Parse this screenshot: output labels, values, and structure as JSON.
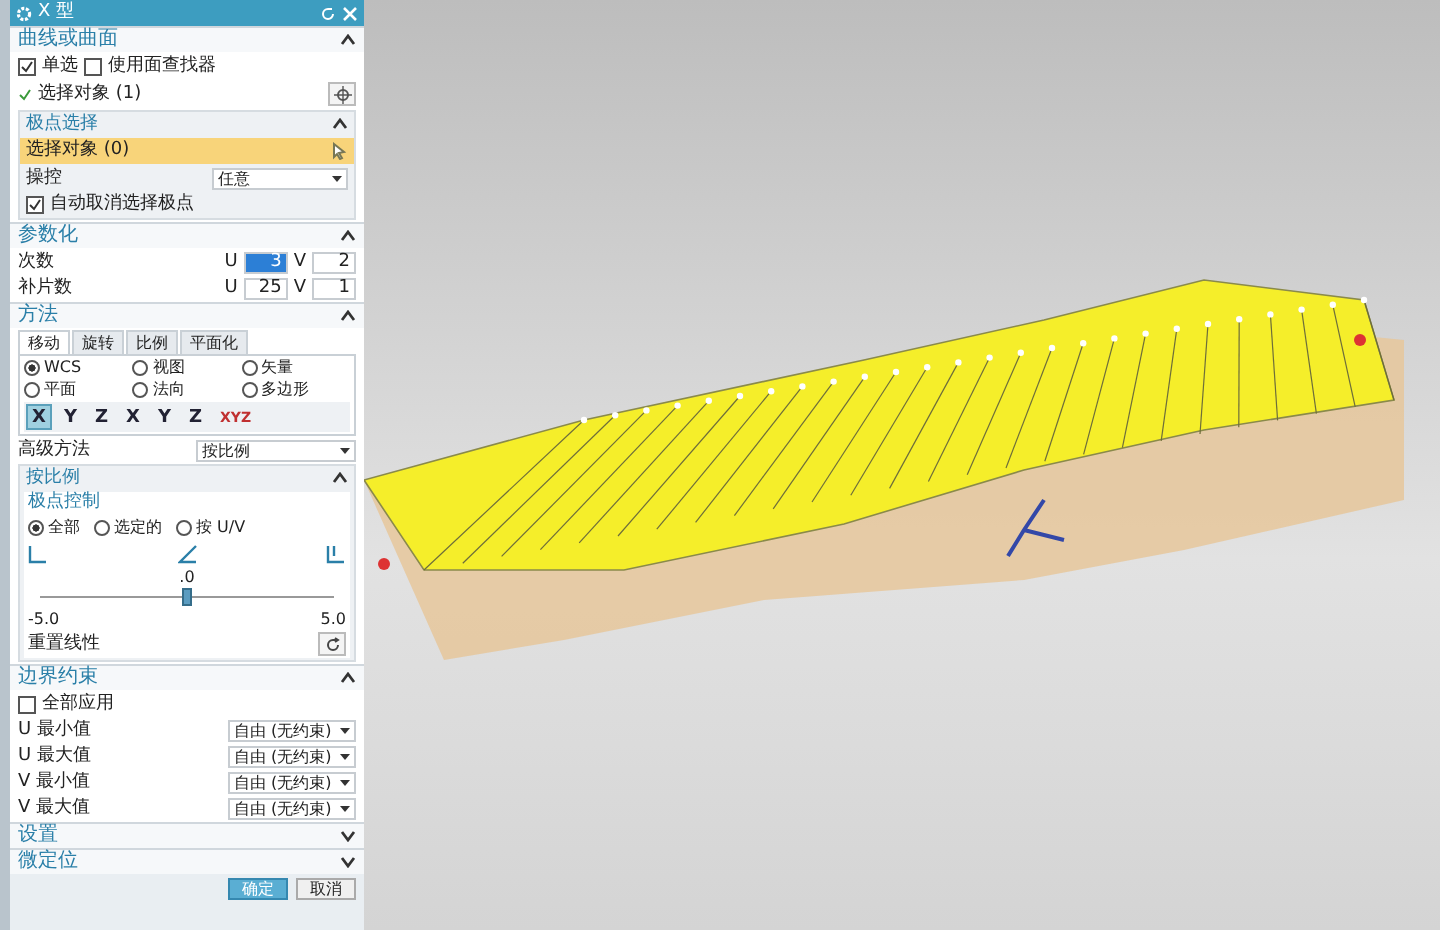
{
  "window": {
    "title": "X 型"
  },
  "curve_section": {
    "title": "曲线或曲面",
    "expanded": true,
    "checkboxes": [
      {
        "label": "单选",
        "checked": true
      },
      {
        "label": "使用面查找器",
        "checked": false
      }
    ],
    "select_label": "选择对象 (1)",
    "pole_group": {
      "title": "极点选择",
      "expanded": true,
      "select_label": "选择对象 (0)",
      "manipulate_label": "操控",
      "manipulate_value": "任意",
      "auto_deselect": {
        "label": "自动取消选择极点",
        "checked": true
      }
    }
  },
  "param_section": {
    "title": "参数化",
    "expanded": true,
    "rows": [
      {
        "label": "次数",
        "u_label": "U",
        "u_value": "3",
        "u_focused": true,
        "v_label": "V",
        "v_value": "2"
      },
      {
        "label": "补片数",
        "u_label": "U",
        "u_value": "25",
        "u_focused": false,
        "v_label": "V",
        "v_value": "1"
      }
    ]
  },
  "method_section": {
    "title": "方法",
    "expanded": true,
    "tabs": [
      {
        "label": "移动",
        "selected": true
      },
      {
        "label": "旋转",
        "selected": false
      },
      {
        "label": "比例",
        "selected": false
      },
      {
        "label": "平面化",
        "selected": false
      }
    ],
    "radios": [
      {
        "label": "WCS",
        "selected": true
      },
      {
        "label": "视图",
        "selected": false
      },
      {
        "label": "矢量",
        "selected": false
      },
      {
        "label": "平面",
        "selected": false
      },
      {
        "label": "法向",
        "selected": false
      },
      {
        "label": "多边形",
        "selected": false
      }
    ],
    "axis_buttons": [
      {
        "label": "X",
        "selected": true
      },
      {
        "label": "Y",
        "selected": false
      },
      {
        "label": "Z",
        "selected": false
      },
      {
        "label": "X",
        "selected": false
      },
      {
        "label": "Y",
        "selected": false
      },
      {
        "label": "Z",
        "selected": false
      },
      {
        "label": "XYZ",
        "selected": false
      }
    ],
    "advanced_label": "高级方法",
    "advanced_value": "按比例",
    "scale_group": {
      "title": "按比例",
      "expanded": true,
      "pole_control": "极点控制",
      "radios": [
        {
          "label": "全部",
          "selected": true
        },
        {
          "label": "选定的",
          "selected": false
        },
        {
          "label": "按 U/V",
          "selected": false
        }
      ],
      "value": ".0",
      "level": 0.5,
      "min": "-5.0",
      "max": "5.0",
      "reset_label": "重置线性"
    }
  },
  "boundary_section": {
    "title": "边界约束",
    "expanded": true,
    "apply_all": {
      "label": "全部应用",
      "checked": false
    },
    "rows": [
      {
        "label": "U 最小值",
        "value": "自由 (无约束)"
      },
      {
        "label": "U 最大值",
        "value": "自由 (无约束)"
      },
      {
        "label": "V 最小值",
        "value": "自由 (无约束)"
      },
      {
        "label": "V 最大值",
        "value": "自由 (无约束)"
      }
    ]
  },
  "collapsed_sections": [
    {
      "title": "设置",
      "expanded": false
    },
    {
      "title": "微定位",
      "expanded": false
    }
  ],
  "buttons": [
    {
      "label": "确定",
      "kind": "primary"
    },
    {
      "label": "取消",
      "kind": "secondary"
    }
  ]
}
